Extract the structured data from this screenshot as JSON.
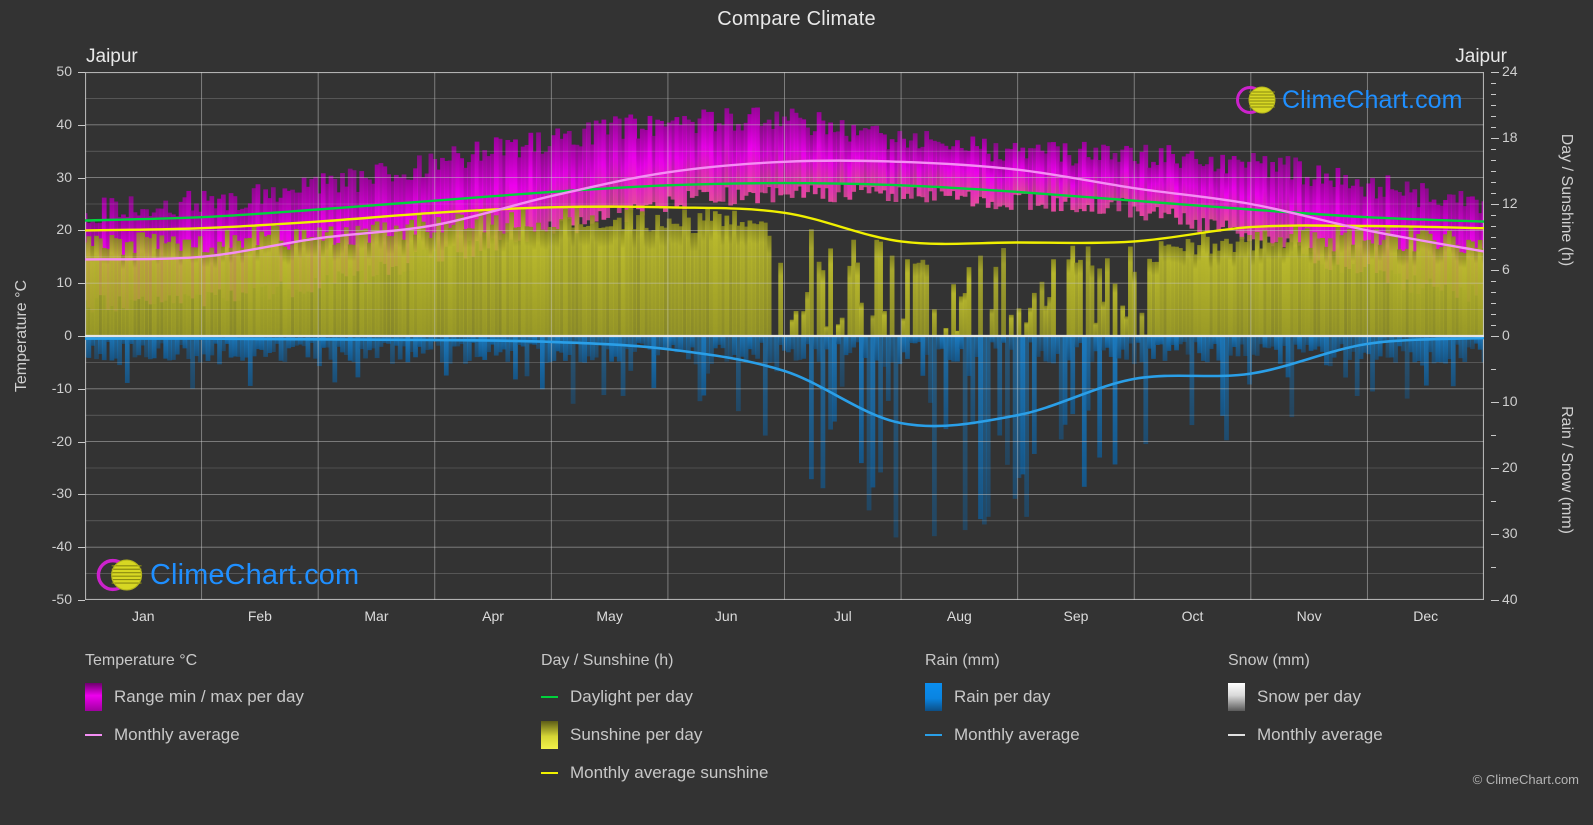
{
  "header": {
    "title": "Compare Climate",
    "city_left": "Jaipur",
    "city_right": "Jaipur"
  },
  "branding": {
    "logo_text": "ClimeChart.com",
    "copyright": "© ClimeChart.com",
    "logo_ring_color": "#cc22cc",
    "logo_sphere_color": "#d7d723",
    "logo_text_color": "#1f8fff"
  },
  "axes": {
    "left": {
      "label": "Temperature °C",
      "ticks": [
        "50",
        "40",
        "30",
        "20",
        "10",
        "0",
        "-10",
        "-20",
        "-30",
        "-40",
        "-50"
      ],
      "min": -50,
      "max": 50
    },
    "right_top": {
      "label": "Day / Sunshine (h)",
      "ticks": [
        "24",
        "18",
        "12",
        "6",
        "0"
      ],
      "min": 0,
      "max": 24
    },
    "right_bottom": {
      "label": "Rain / Snow (mm)",
      "ticks": [
        "0",
        "10",
        "20",
        "30",
        "40"
      ],
      "min": 0,
      "max": 40
    },
    "x": {
      "ticks": [
        "Jan",
        "Feb",
        "Mar",
        "Apr",
        "May",
        "Jun",
        "Jul",
        "Aug",
        "Sep",
        "Oct",
        "Nov",
        "Dec"
      ]
    }
  },
  "legend": {
    "groups": [
      {
        "name": "temperature",
        "title": "Temperature °C",
        "items": [
          {
            "type": "swatch",
            "label": "Range min / max per day",
            "color": "#ee00ee"
          },
          {
            "type": "line",
            "label": "Monthly average",
            "color": "#f48ff4"
          }
        ]
      },
      {
        "name": "day-sunshine",
        "title": "Day / Sunshine (h)",
        "items": [
          {
            "type": "line",
            "label": "Daylight per day",
            "color": "#00d23c"
          },
          {
            "type": "swatch",
            "label": "Sunshine per day",
            "color": "#e8e83c"
          },
          {
            "type": "line",
            "label": "Monthly average sunshine",
            "color": "#f0f000"
          }
        ]
      },
      {
        "name": "rain",
        "title": "Rain (mm)",
        "items": [
          {
            "type": "swatch",
            "label": "Rain per day",
            "color": "#0a84e0"
          },
          {
            "type": "line",
            "label": "Monthly average",
            "color": "#2a9fe8"
          }
        ]
      },
      {
        "name": "snow",
        "title": "Snow (mm)",
        "items": [
          {
            "type": "swatch",
            "label": "Snow per day",
            "color": "#f0f0f0"
          },
          {
            "type": "line",
            "label": "Monthly average",
            "color": "#e0e0e0"
          }
        ]
      }
    ]
  },
  "chart_data": {
    "type": "line",
    "title": "Compare Climate",
    "subtitle": "Jaipur",
    "xlabel": "",
    "ylabel": "Temperature °C",
    "ylim": [
      -50,
      50
    ],
    "grid": true,
    "legend_position": "bottom",
    "categories": [
      "Jan",
      "Feb",
      "Mar",
      "Apr",
      "May",
      "Jun",
      "Jul",
      "Aug",
      "Sep",
      "Oct",
      "Nov",
      "Dec"
    ],
    "series": [
      {
        "name": "Monthly average temperature",
        "unit": "°C",
        "axis": "left",
        "color": "#f48ff4",
        "values": [
          14.5,
          15.0,
          18.5,
          21.0,
          26.5,
          31.0,
          33.0,
          33.0,
          31.5,
          28.0,
          25.0,
          20.0,
          16.0
        ]
      },
      {
        "name": "Daily max temperature (band top)",
        "unit": "°C",
        "axis": "left",
        "color": "#ee00ee",
        "values": [
          24.0,
          25.5,
          28.5,
          33.0,
          37.5,
          40.5,
          41.0,
          37.5,
          35.0,
          34.5,
          33.0,
          29.0,
          25.0
        ]
      },
      {
        "name": "Daily min temperature (band bottom)",
        "unit": "°C",
        "axis": "left",
        "color": "#ee00ee",
        "values": [
          6.0,
          7.0,
          10.0,
          15.0,
          20.0,
          25.0,
          27.0,
          26.5,
          25.5,
          24.0,
          19.0,
          12.0,
          7.5
        ]
      },
      {
        "name": "Daylight per day",
        "unit": "h",
        "axis": "right_top",
        "color": "#00d23c",
        "values": [
          10.5,
          10.8,
          11.5,
          12.3,
          13.1,
          13.7,
          13.9,
          13.7,
          13.1,
          12.3,
          11.5,
          10.8,
          10.4
        ]
      },
      {
        "name": "Monthly average sunshine",
        "unit": "h",
        "axis": "right_top",
        "color": "#f0f000",
        "values": [
          9.6,
          9.8,
          10.4,
          11.2,
          11.7,
          11.7,
          11.2,
          8.6,
          8.5,
          8.6,
          9.9,
          10.0,
          9.8
        ]
      },
      {
        "name": "Monthly average rain",
        "unit": "mm",
        "axis": "right_bottom",
        "color": "#2a9fe8",
        "values": [
          0.4,
          0.4,
          0.5,
          0.6,
          0.9,
          2.0,
          5.3,
          13.2,
          12.0,
          6.5,
          5.7,
          1.2,
          0.3
        ]
      },
      {
        "name": "Monthly average snow",
        "unit": "mm",
        "axis": "right_bottom",
        "color": "#e0e0e0",
        "values": [
          0,
          0,
          0,
          0,
          0,
          0,
          0,
          0,
          0,
          0,
          0,
          0,
          0
        ]
      }
    ]
  }
}
